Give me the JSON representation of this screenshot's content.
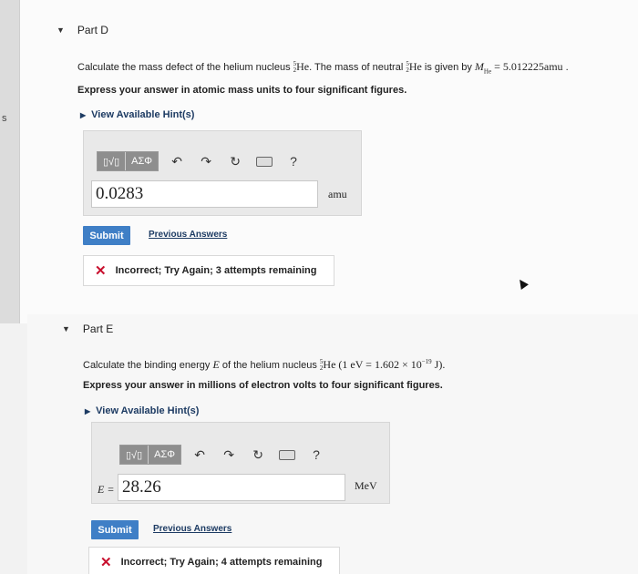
{
  "side_tab_letter": "s",
  "part_d": {
    "title": "Part D",
    "question_pre": "Calculate the mass defect of the helium nucleus ",
    "nuclide_mass": "5",
    "nuclide_atomic": "2",
    "nuclide_symbol": "He",
    "question_mid": ". The mass of neutral ",
    "question_given": " is given by ",
    "mass_symbol": "M",
    "mass_sub": "He",
    "mass_value": " = 5.012225amu",
    "question_end": " .",
    "instruction": "Express your answer in atomic mass units to four significant figures.",
    "hint_label": "View Available Hint(s)",
    "toolbar": {
      "templates": "▯√▯",
      "greek": "ΑΣΦ",
      "help": "?"
    },
    "answer_value": "0.0283",
    "unit": "amu",
    "submit_label": "Submit",
    "previous_answers_label": "Previous Answers",
    "feedback": "Incorrect; Try Again; 3 attempts remaining"
  },
  "part_e": {
    "title": "Part E",
    "question_pre": "Calculate the binding energy ",
    "energy_symbol": "E",
    "question_mid": " of the helium nucleus ",
    "nuclide_mass": "5",
    "nuclide_atomic": "2",
    "nuclide_symbol": "He",
    "conversion_pre": " (1 eV = 1.602 × 10",
    "conversion_exp": "−19",
    "conversion_post": " J).",
    "instruction": "Express your answer in millions of electron volts to four significant figures.",
    "hint_label": "View Available Hint(s)",
    "toolbar": {
      "templates": "▯√▯",
      "greek": "ΑΣΦ",
      "help": "?"
    },
    "variable_label": "E =",
    "answer_value": "28.26",
    "unit": "MeV",
    "submit_label": "Submit",
    "previous_answers_label": "Previous Answers",
    "feedback": "Incorrect; Try Again; 4 attempts remaining"
  },
  "colors": {
    "submit": "#3f7fc6",
    "link": "#1d3b63",
    "error": "#c8102e"
  }
}
